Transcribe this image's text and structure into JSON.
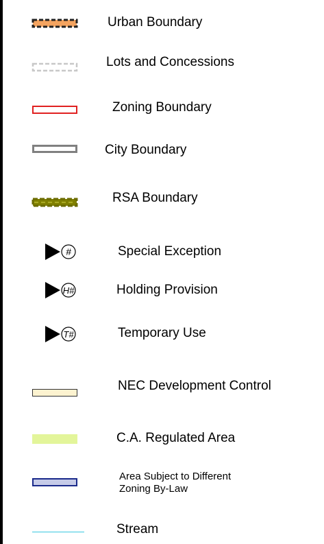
{
  "legend": {
    "items": [
      {
        "key": "urban",
        "label": "Urban Boundary",
        "symbol": "dashed-box",
        "fill": "#f4a460",
        "stroke": "#222222"
      },
      {
        "key": "lots",
        "label": "Lots and Concessions",
        "symbol": "dashed-box",
        "fill": "#ffffff",
        "stroke": "#c8c8c8"
      },
      {
        "key": "zoning",
        "label": "Zoning Boundary",
        "symbol": "box",
        "fill": "#ffffff",
        "stroke": "#e02020"
      },
      {
        "key": "city",
        "label": "City Boundary",
        "symbol": "box",
        "fill": "#ffffff",
        "stroke": "#808080"
      },
      {
        "key": "rsa",
        "label": "RSA Boundary",
        "symbol": "dashed-box",
        "fill": "#808000",
        "stroke": "#7a7a00"
      },
      {
        "key": "special",
        "label": "Special Exception",
        "symbol": "marker",
        "marker_text": "#"
      },
      {
        "key": "holding",
        "label": "Holding Provision",
        "symbol": "marker",
        "marker_text": "H#"
      },
      {
        "key": "temporary",
        "label": "Temporary Use",
        "symbol": "marker",
        "marker_text": "T#"
      },
      {
        "key": "nec",
        "label": "NEC Development Control",
        "symbol": "box",
        "fill": "#fdf3d0",
        "stroke": "#333333"
      },
      {
        "key": "ca",
        "label": "C.A. Regulated Area",
        "symbol": "fill",
        "fill": "#e3f59a"
      },
      {
        "key": "area_bylaw",
        "label": "Area Subject to Different Zoning  By-Law",
        "symbol": "box",
        "fill": "#c6cbe8",
        "stroke": "#1a2a8a"
      },
      {
        "key": "stream",
        "label": "Stream",
        "symbol": "line",
        "stroke": "#38c8e0"
      }
    ]
  }
}
